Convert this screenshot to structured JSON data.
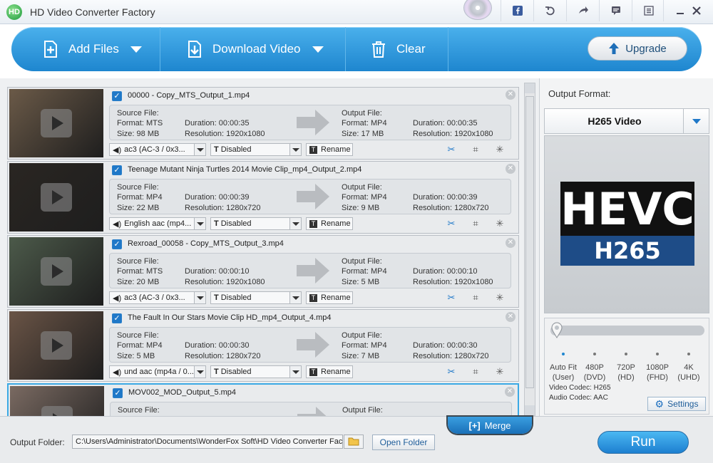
{
  "app": {
    "title": "HD Video Converter Factory",
    "logo_text": "HD"
  },
  "toolbar": {
    "add_files": "Add Files",
    "download_video": "Download Video",
    "clear": "Clear",
    "upgrade": "Upgrade"
  },
  "labels": {
    "source_file": "Source File:",
    "output_file": "Output File:",
    "format": "Format:",
    "size": "Size:",
    "duration": "Duration:",
    "resolution": "Resolution:",
    "rename": "Rename",
    "subtitle": "Disabled"
  },
  "items": [
    {
      "name": "00000 - Copy_MTS_Output_1.mp4",
      "src_format": "MTS",
      "src_size": "98 MB",
      "src_duration": "00:00:35",
      "src_res": "1920x1080",
      "out_format": "MP4",
      "out_size": "17 MB",
      "out_duration": "00:00:35",
      "out_res": "1920x1080",
      "audio": "ac3 (AC-3 / 0x3...",
      "thumb_color": "#6b5a48"
    },
    {
      "name": "Teenage Mutant Ninja Turtles 2014 Movie Clip_mp4_Output_2.mp4",
      "src_format": "MP4",
      "src_size": "22 MB",
      "src_duration": "00:00:39",
      "src_res": "1280x720",
      "out_format": "MP4",
      "out_size": "9 MB",
      "out_duration": "00:00:39",
      "out_res": "1280x720",
      "audio": "English aac (mp4...",
      "thumb_color": "#2a2622"
    },
    {
      "name": "Rexroad_00058 - Copy_MTS_Output_3.mp4",
      "src_format": "MTS",
      "src_size": "20 MB",
      "src_duration": "00:00:10",
      "src_res": "1920x1080",
      "out_format": "MP4",
      "out_size": "5 MB",
      "out_duration": "00:00:10",
      "out_res": "1920x1080",
      "audio": "ac3 (AC-3 / 0x3...",
      "thumb_color": "#4c5a4a"
    },
    {
      "name": "The Fault In Our Stars Movie Clip HD_mp4_Output_4.mp4",
      "src_format": "MP4",
      "src_size": "5 MB",
      "src_duration": "00:00:30",
      "src_res": "1280x720",
      "out_format": "MP4",
      "out_size": "7 MB",
      "out_duration": "00:00:30",
      "out_res": "1280x720",
      "audio": "und aac (mp4a / 0...",
      "thumb_color": "#6a5446"
    },
    {
      "name": "MOV002_MOD_Output_5.mp4",
      "thumb_color": "#7a6a62"
    }
  ],
  "output_format": {
    "label": "Output Format:",
    "selected": "H265 Video",
    "logo_top": "HEVC",
    "logo_bottom": "H265"
  },
  "quality": {
    "options": [
      {
        "label": "Auto Fit",
        "sub": "(User)"
      },
      {
        "label": "480P",
        "sub": "(DVD)"
      },
      {
        "label": "720P",
        "sub": "(HD)"
      },
      {
        "label": "1080P",
        "sub": "(FHD)"
      },
      {
        "label": "4K",
        "sub": "(UHD)"
      }
    ],
    "selected_index": 0
  },
  "codec": {
    "video": "Video Codec: H265",
    "audio": "Audio Codec: AAC"
  },
  "settings_label": "Settings",
  "bottom": {
    "output_folder_label": "Output Folder:",
    "output_folder_path": "C:\\Users\\Administrator\\Documents\\WonderFox Soft\\HD Video Converter Fac",
    "open_folder": "Open Folder",
    "merge": "Merge",
    "run": "Run"
  },
  "colors": {
    "accent": "#1f86d0",
    "brand_dark": "#1e4c87"
  }
}
